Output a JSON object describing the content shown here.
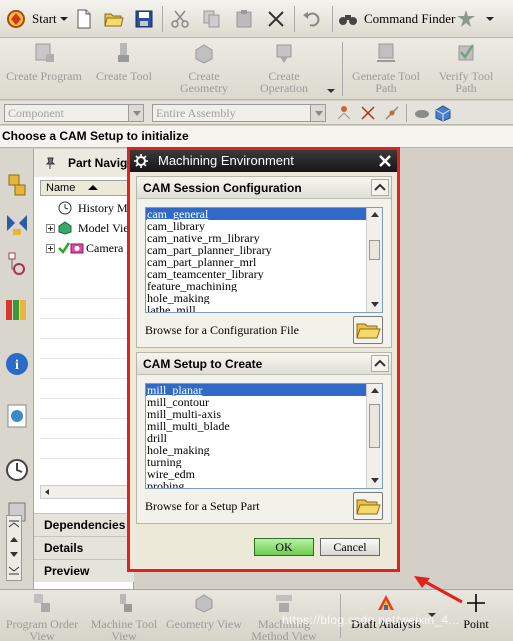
{
  "toolbar": {
    "start_label": "Start",
    "command_finder_label": "Command Finder"
  },
  "ribbon_top": {
    "buttons": [
      {
        "label1": "Create Program",
        "label2": ""
      },
      {
        "label1": "Create Tool",
        "label2": ""
      },
      {
        "label1": "Create",
        "label2": "Geometry"
      },
      {
        "label1": "Create",
        "label2": "Operation"
      },
      {
        "label1": "Generate Tool",
        "label2": "Path"
      },
      {
        "label1": "Verify Tool",
        "label2": "Path"
      }
    ]
  },
  "filter_bar": {
    "type_filter": "Component",
    "scope_filter": "Entire Assembly"
  },
  "cue_line": "Choose a CAM Setup to initialize",
  "navigator": {
    "title": "Part Navig",
    "column_name": "Name",
    "items": [
      "History Mo",
      "Model Vie",
      "Camera"
    ],
    "sections": [
      "Dependencies",
      "Details",
      "Preview"
    ]
  },
  "dialog": {
    "title": "Machining Environment",
    "session_config": {
      "heading": "CAM Session Configuration",
      "items": [
        "cam_general",
        "cam_library",
        "cam_native_rm_library",
        "cam_part_planner_library",
        "cam_part_planner_mrl",
        "cam_teamcenter_library",
        "feature_machining",
        "hole_making",
        "lathe_mill"
      ],
      "selected": "cam_general",
      "browse_label": "Browse for a Configuration File"
    },
    "setup": {
      "heading": "CAM Setup to Create",
      "items": [
        "mill_planar",
        "mill_contour",
        "mill_multi-axis",
        "mill_multi_blade",
        "drill",
        "hole_making",
        "turning",
        "wire_edm",
        "probing"
      ],
      "selected": "mill_planar",
      "browse_label": "Browse for a Setup Part"
    },
    "ok_label": "OK",
    "cancel_label": "Cancel"
  },
  "ribbon_bottom": {
    "buttons": [
      {
        "label1": "Program Order",
        "label2": "View"
      },
      {
        "label1": "Machine Tool",
        "label2": "View"
      },
      {
        "label1": "Geometry View",
        "label2": ""
      },
      {
        "label1": "Machining",
        "label2": "Method View"
      },
      {
        "label1": "Draft Analysis",
        "label2": ""
      },
      {
        "label1": "Point",
        "label2": ""
      }
    ]
  },
  "watermark": "https://blog.csdn.net/weixin_4...",
  "colors": {
    "highlight_border": "#e0211c",
    "selection": "#3169c6",
    "ok_green": "#6ccc4e"
  }
}
